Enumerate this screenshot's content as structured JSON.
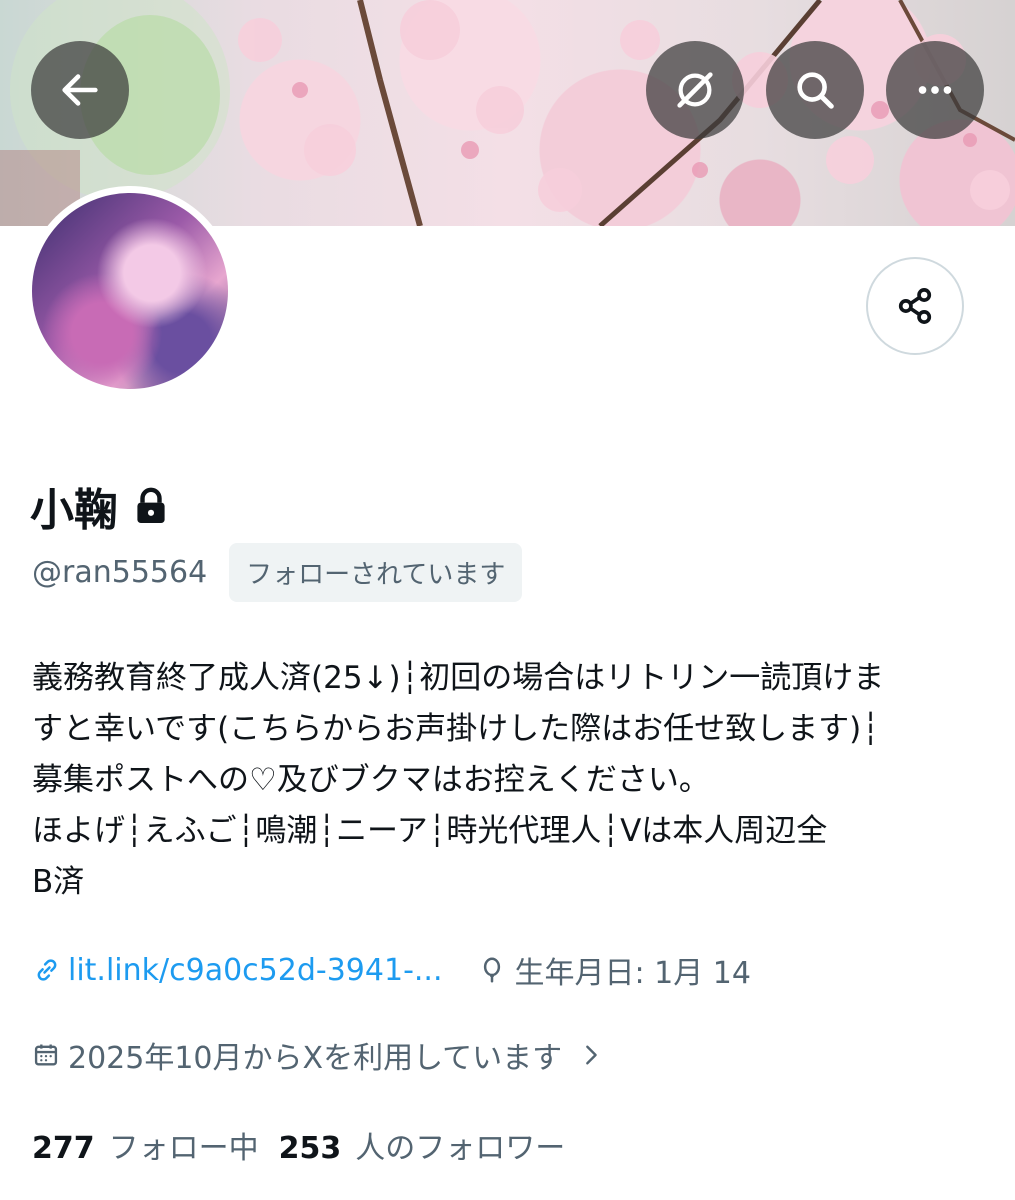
{
  "profile": {
    "display_name": "小鞠",
    "handle": "@ran55564",
    "follows_you": "フォローされています",
    "bio_lines": [
      "義務教育終了成人済(25↓)┆初回の場合はリトリン一読頂けま",
      "すと幸いです(こちらからお声掛けした際はお任せ致します)┆",
      "募集ポストへの♡及びブクマはお控えください。",
      "ほよげ┆えふご┆鳴潮┆ニーア┆時光代理人┆Vは本人周辺全",
      "B済"
    ],
    "link": "lit.link/c9a0c52d-3941-...",
    "birthday": "生年月日: 1月 14",
    "joined": "2025年10月からXを利用しています",
    "following_count": "277",
    "following_label": "フォロー中",
    "followers_count": "253",
    "followers_label": "人のフォロワー"
  },
  "icons": {
    "back": "back-arrow-icon",
    "grok": "grok-icon",
    "search": "search-icon",
    "more": "more-icon",
    "share": "share-icon",
    "lock": "lock-icon",
    "link": "link-icon",
    "birthday": "balloon-icon",
    "calendar": "calendar-icon",
    "chevron": "chevron-right-icon"
  },
  "colors": {
    "link": "#1d9bf0",
    "secondary_text": "#536471",
    "primary_text": "#0f1419"
  }
}
